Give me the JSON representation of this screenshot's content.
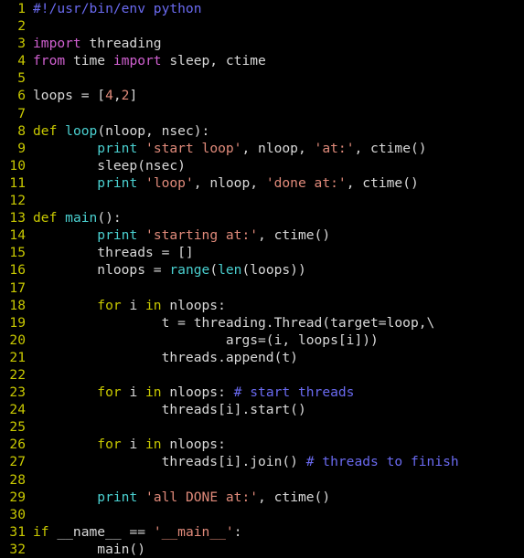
{
  "editor": {
    "language": "python",
    "background_color": "#000000",
    "gutter_color": "#c8c800",
    "default_text_color": "#d8d8d8",
    "token_colors": {
      "comment": "#6a6af0",
      "keyword": "#c8c800",
      "import": "#d060d0",
      "builtin": "#4ad0d0",
      "function_name": "#4ad0d0",
      "string": "#e08a7a",
      "number": "#e08a7a"
    },
    "first_line": 1,
    "last_line": 32,
    "total_lines": 32,
    "lines": [
      {
        "n": "1",
        "tokens": [
          {
            "t": "#!/usr/bin/env python",
            "c": "comment"
          }
        ]
      },
      {
        "n": "2",
        "tokens": []
      },
      {
        "n": "3",
        "tokens": [
          {
            "t": "import",
            "c": "import"
          },
          {
            "t": " threading",
            "c": "default"
          }
        ]
      },
      {
        "n": "4",
        "tokens": [
          {
            "t": "from",
            "c": "import"
          },
          {
            "t": " time ",
            "c": "default"
          },
          {
            "t": "import",
            "c": "import"
          },
          {
            "t": " sleep, ctime",
            "c": "default"
          }
        ]
      },
      {
        "n": "5",
        "tokens": []
      },
      {
        "n": "6",
        "tokens": [
          {
            "t": "loops = [",
            "c": "default"
          },
          {
            "t": "4",
            "c": "number"
          },
          {
            "t": ",",
            "c": "default"
          },
          {
            "t": "2",
            "c": "number"
          },
          {
            "t": "]",
            "c": "default"
          }
        ]
      },
      {
        "n": "7",
        "tokens": []
      },
      {
        "n": "8",
        "tokens": [
          {
            "t": "def",
            "c": "keyword"
          },
          {
            "t": " ",
            "c": "default"
          },
          {
            "t": "loop",
            "c": "funcname"
          },
          {
            "t": "(nloop, nsec):",
            "c": "default"
          }
        ]
      },
      {
        "n": "9",
        "tokens": [
          {
            "t": "        ",
            "c": "default"
          },
          {
            "t": "print",
            "c": "builtin"
          },
          {
            "t": " ",
            "c": "default"
          },
          {
            "t": "'start loop'",
            "c": "string"
          },
          {
            "t": ", nloop, ",
            "c": "default"
          },
          {
            "t": "'at:'",
            "c": "string"
          },
          {
            "t": ", ctime()",
            "c": "default"
          }
        ]
      },
      {
        "n": "10",
        "tokens": [
          {
            "t": "        sleep(nsec)",
            "c": "default"
          }
        ]
      },
      {
        "n": "11",
        "tokens": [
          {
            "t": "        ",
            "c": "default"
          },
          {
            "t": "print",
            "c": "builtin"
          },
          {
            "t": " ",
            "c": "default"
          },
          {
            "t": "'loop'",
            "c": "string"
          },
          {
            "t": ", nloop, ",
            "c": "default"
          },
          {
            "t": "'done at:'",
            "c": "string"
          },
          {
            "t": ", ctime()",
            "c": "default"
          }
        ]
      },
      {
        "n": "12",
        "tokens": []
      },
      {
        "n": "13",
        "tokens": [
          {
            "t": "def",
            "c": "keyword"
          },
          {
            "t": " ",
            "c": "default"
          },
          {
            "t": "main",
            "c": "funcname"
          },
          {
            "t": "():",
            "c": "default"
          }
        ]
      },
      {
        "n": "14",
        "tokens": [
          {
            "t": "        ",
            "c": "default"
          },
          {
            "t": "print",
            "c": "builtin"
          },
          {
            "t": " ",
            "c": "default"
          },
          {
            "t": "'starting at:'",
            "c": "string"
          },
          {
            "t": ", ctime()",
            "c": "default"
          }
        ]
      },
      {
        "n": "15",
        "tokens": [
          {
            "t": "        threads = []",
            "c": "default"
          }
        ]
      },
      {
        "n": "16",
        "tokens": [
          {
            "t": "        nloops = ",
            "c": "default"
          },
          {
            "t": "range",
            "c": "builtin"
          },
          {
            "t": "(",
            "c": "default"
          },
          {
            "t": "len",
            "c": "builtin"
          },
          {
            "t": "(loops))",
            "c": "default"
          }
        ]
      },
      {
        "n": "17",
        "tokens": []
      },
      {
        "n": "18",
        "tokens": [
          {
            "t": "        ",
            "c": "default"
          },
          {
            "t": "for",
            "c": "keyword"
          },
          {
            "t": " i ",
            "c": "default"
          },
          {
            "t": "in",
            "c": "keyword"
          },
          {
            "t": " nloops:",
            "c": "default"
          }
        ]
      },
      {
        "n": "19",
        "tokens": [
          {
            "t": "                t = threading.Thread(target=loop,\\",
            "c": "default"
          }
        ]
      },
      {
        "n": "20",
        "tokens": [
          {
            "t": "                        args=(i, loops[i]))",
            "c": "default"
          }
        ]
      },
      {
        "n": "21",
        "tokens": [
          {
            "t": "                threads.append(t)",
            "c": "default"
          }
        ]
      },
      {
        "n": "22",
        "tokens": []
      },
      {
        "n": "23",
        "tokens": [
          {
            "t": "        ",
            "c": "default"
          },
          {
            "t": "for",
            "c": "keyword"
          },
          {
            "t": " i ",
            "c": "default"
          },
          {
            "t": "in",
            "c": "keyword"
          },
          {
            "t": " nloops: ",
            "c": "default"
          },
          {
            "t": "# start threads",
            "c": "comment"
          }
        ]
      },
      {
        "n": "24",
        "tokens": [
          {
            "t": "                threads[i].start()",
            "c": "default"
          }
        ]
      },
      {
        "n": "25",
        "tokens": []
      },
      {
        "n": "26",
        "tokens": [
          {
            "t": "        ",
            "c": "default"
          },
          {
            "t": "for",
            "c": "keyword"
          },
          {
            "t": " i ",
            "c": "default"
          },
          {
            "t": "in",
            "c": "keyword"
          },
          {
            "t": " nloops:",
            "c": "default"
          }
        ]
      },
      {
        "n": "27",
        "tokens": [
          {
            "t": "                threads[i].join() ",
            "c": "default"
          },
          {
            "t": "# threads to finish",
            "c": "comment"
          }
        ]
      },
      {
        "n": "28",
        "tokens": []
      },
      {
        "n": "29",
        "tokens": [
          {
            "t": "        ",
            "c": "default"
          },
          {
            "t": "print",
            "c": "builtin"
          },
          {
            "t": " ",
            "c": "default"
          },
          {
            "t": "'all DONE at:'",
            "c": "string"
          },
          {
            "t": ", ctime()",
            "c": "default"
          }
        ]
      },
      {
        "n": "30",
        "tokens": []
      },
      {
        "n": "31",
        "tokens": [
          {
            "t": "if",
            "c": "keyword"
          },
          {
            "t": " __name__ == ",
            "c": "default"
          },
          {
            "t": "'__main__'",
            "c": "string"
          },
          {
            "t": ":",
            "c": "default"
          }
        ]
      },
      {
        "n": "32",
        "tokens": [
          {
            "t": "        main()",
            "c": "default"
          }
        ]
      }
    ]
  }
}
